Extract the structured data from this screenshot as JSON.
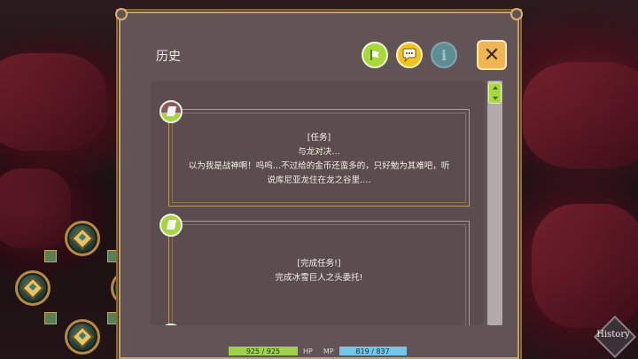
{
  "dialog": {
    "title": "历史",
    "tabs": [
      {
        "name": "quest-tab",
        "icon": "quest-flag-icon"
      },
      {
        "name": "chat-tab",
        "icon": "chat-bubble-icon"
      },
      {
        "name": "info-tab",
        "icon": "info-icon",
        "glyph": "i"
      }
    ],
    "close_glyph": "✕",
    "entries": [
      {
        "status": "active",
        "lines": [
          "[任务]",
          "与龙对决…",
          "以为我是战神啊！呜呜…不过给的金币还蛮多的，只好勉为其难吧，听",
          "说库尼亚龙住在龙之谷里…."
        ]
      },
      {
        "status": "done",
        "lines": [
          "[完成任务!]",
          "完成冰雪巨人之头委托!"
        ]
      },
      {
        "status": "done",
        "lines": []
      }
    ]
  },
  "hud": {
    "hp_value": "925 / 925",
    "hp_label": "HP",
    "mp_label": "MP",
    "mp_value": "819 / 837",
    "history_button": "History"
  },
  "colors": {
    "panel": "#615356",
    "gold_border": "#c9a15e",
    "hp": "#9fd24c",
    "mp": "#74c6e8",
    "accent_green": "#a6d63d"
  }
}
